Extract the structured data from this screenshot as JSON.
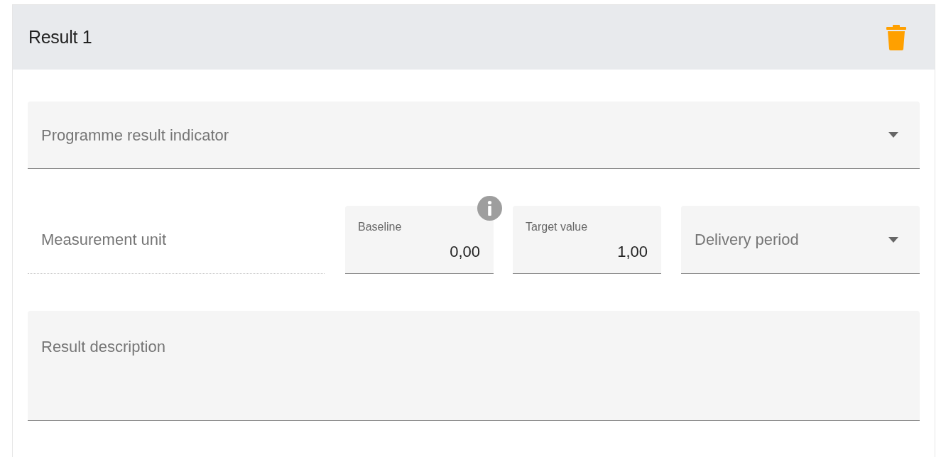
{
  "card": {
    "title": "Result 1",
    "delete_button": true
  },
  "fields": [
    {
      "kind": "select",
      "placeholder": "Programme result indicator",
      "disabled": false
    },
    {
      "kind": "text",
      "placeholder": "Measurement unit",
      "disabled": true
    },
    {
      "kind": "number",
      "label": "Baseline",
      "value": "0,00",
      "info": true,
      "disabled": false
    },
    {
      "kind": "number",
      "label": "Target value",
      "value": "1,00",
      "info": false,
      "disabled": false
    },
    {
      "kind": "select",
      "placeholder": "Delivery period",
      "disabled": false
    },
    {
      "kind": "textarea",
      "placeholder": "Result description",
      "disabled": false
    }
  ]
}
